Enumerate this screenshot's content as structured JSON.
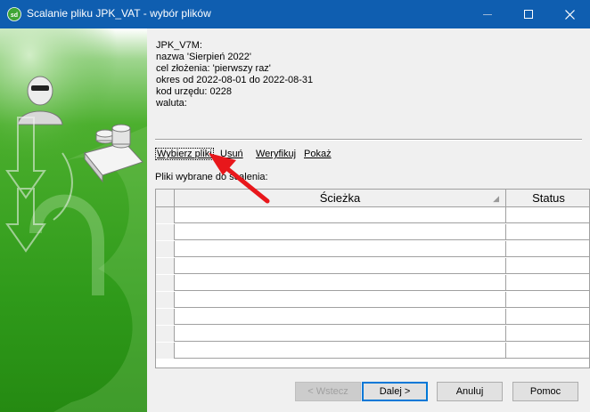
{
  "window": {
    "title": "Scalanie pliku JPK_VAT - wybór plików",
    "app_icon": "sd-app-icon"
  },
  "info": {
    "line1": "JPK_V7M:",
    "line2": "nazwa 'Sierpień 2022'",
    "line3": "cel złożenia: 'pierwszy raz'",
    "line4": "okres od 2022-08-01 do 2022-08-31",
    "line5": "kod urzędu: 0228",
    "line6": "waluta:"
  },
  "links": {
    "choose": "Wybierz pliki",
    "remove": "Usuń",
    "verify": "Weryfikuj",
    "show": "Pokaż"
  },
  "picked_label": "Pliki wybrane do scalenia:",
  "table": {
    "columns": [
      "Ścieżka",
      "Status"
    ],
    "rows": 9
  },
  "buttons": {
    "back": "< Wstecz",
    "next": "Dalej >",
    "cancel": "Anuluj",
    "help": "Pomoc"
  },
  "colors": {
    "titlebar": "#0f5eb0",
    "annotation_arrow": "#e8171b",
    "panel_green": "#2f9a1a"
  }
}
